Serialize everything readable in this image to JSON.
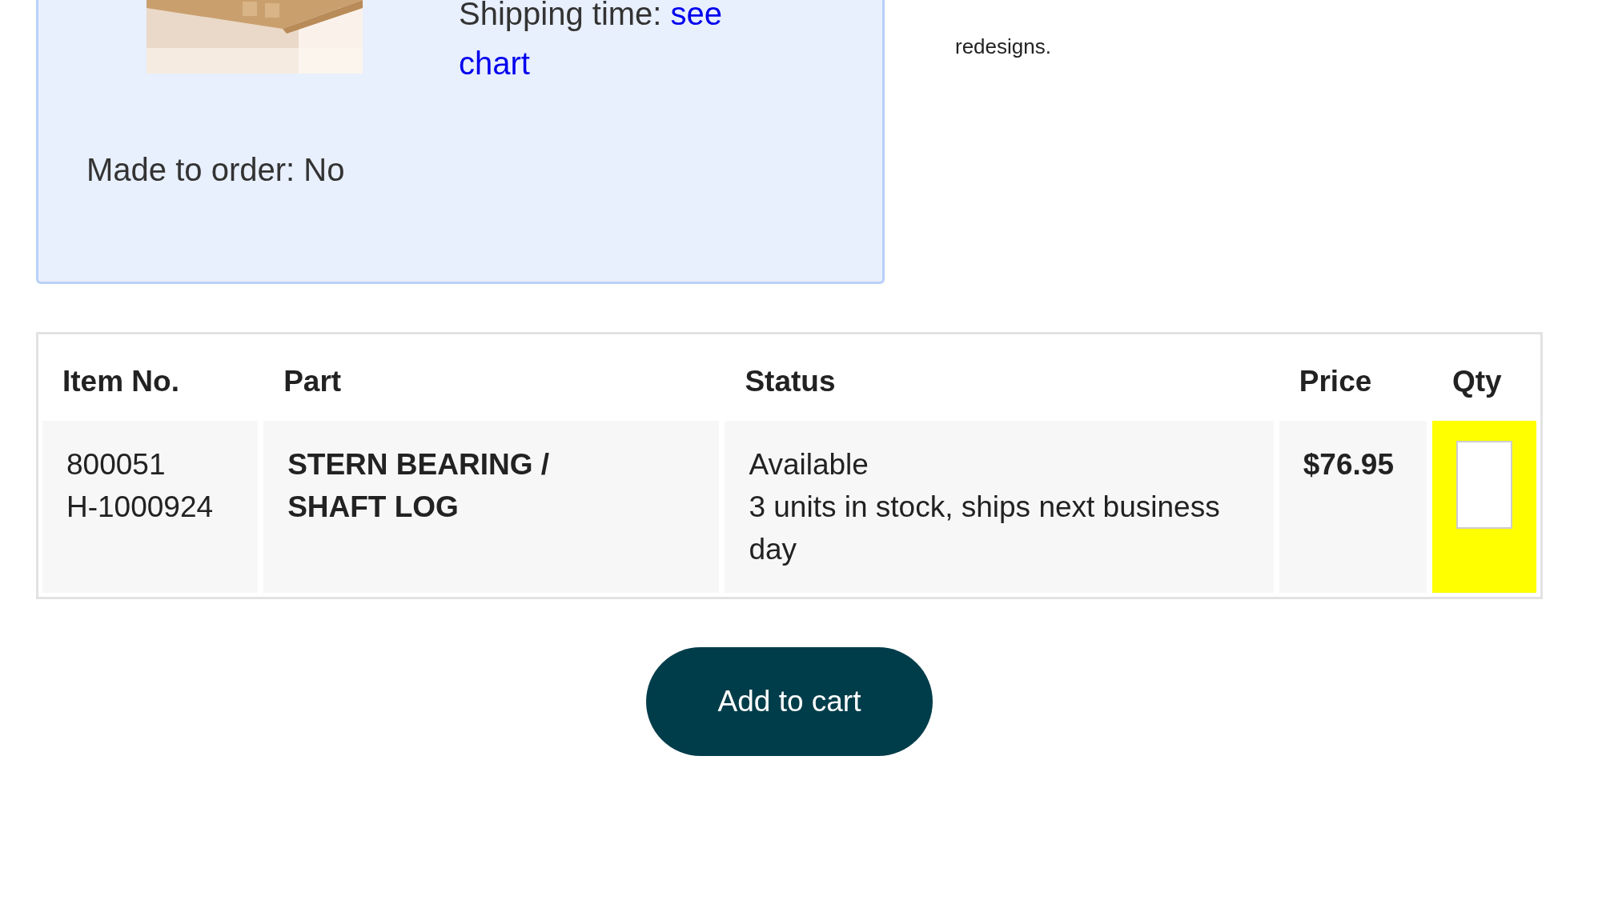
{
  "product_card": {
    "shipping_label": "Shipping time:",
    "shipping_link": [
      "see",
      "chart"
    ],
    "made_to_order": "Made to order: No"
  },
  "side_note": "redesigns.",
  "table": {
    "columns": [
      "Item No.",
      "Part",
      "Status",
      "Price",
      "Qty"
    ],
    "rows": [
      {
        "item_no": [
          "800051",
          "H-1000924"
        ],
        "part": "STERN BEARING / SHAFT LOG",
        "status": [
          "Available",
          "3 units in stock, ships next business day"
        ],
        "price": "$76.95"
      }
    ]
  },
  "add_button": "Add to cart"
}
